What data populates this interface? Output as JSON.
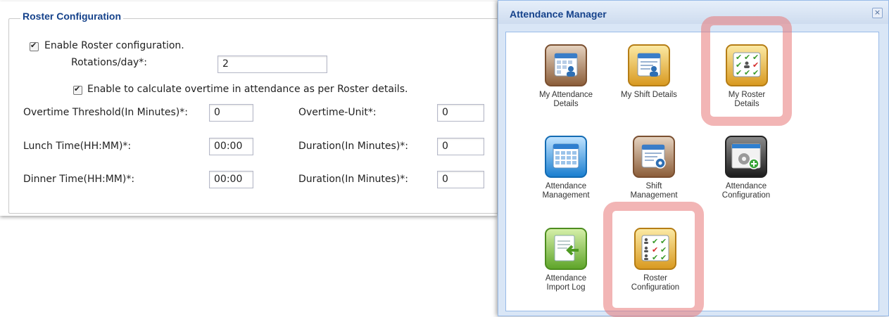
{
  "roster": {
    "legend": "Roster Configuration",
    "enable_label": "Enable Roster configuration.",
    "rotations_label": "Rotations/day*:",
    "rotations_value": "2",
    "overtime_checkbox_label": "Enable to calculate overtime in attendance as per Roster details.",
    "overtime_threshold_label": "Overtime Threshold(In Minutes)*:",
    "overtime_threshold_value": "0",
    "overtime_unit_label": "Overtime-Unit*:",
    "overtime_unit_value": "0",
    "lunch_label": "Lunch Time(HH:MM)*:",
    "lunch_value": "00:00",
    "lunch_duration_label": "Duration(In Minutes)*:",
    "lunch_duration_value": "0",
    "dinner_label": "Dinner Time(HH:MM)*:",
    "dinner_value": "00:00",
    "dinner_duration_label": "Duration(In Minutes)*:",
    "dinner_duration_value": "0"
  },
  "attendance_manager": {
    "title": "Attendance Manager",
    "close_glyph": "×",
    "tiles": [
      {
        "line1": "My Attendance",
        "line2": "Details",
        "icon": "attendance-details-icon"
      },
      {
        "line1": "My Shift Details",
        "line2": "",
        "icon": "shift-details-icon"
      },
      {
        "line1": "My Roster",
        "line2": "Details",
        "icon": "roster-details-icon"
      },
      {
        "line1": "Attendance",
        "line2": "Management",
        "icon": "attendance-management-icon"
      },
      {
        "line1": "Shift",
        "line2": "Management",
        "icon": "shift-management-icon"
      },
      {
        "line1": "Attendance",
        "line2": "Configuration",
        "icon": "attendance-configuration-icon"
      },
      {
        "line1": "Attendance",
        "line2": "Import Log",
        "icon": "import-log-icon"
      },
      {
        "line1": "Roster",
        "line2": "Configuration",
        "icon": "roster-configuration-icon"
      }
    ]
  },
  "colors": {
    "title_blue": "#15428b",
    "window_bg": "#d9e6f6",
    "highlight": "#e87878"
  }
}
